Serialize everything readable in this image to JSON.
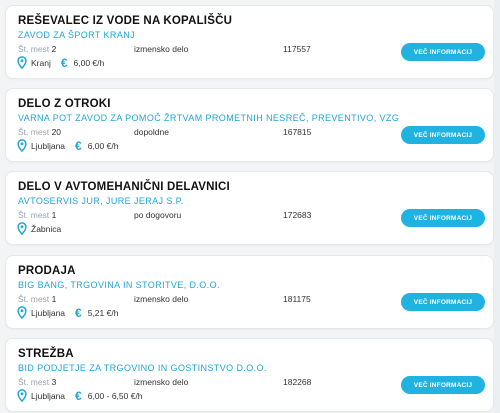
{
  "accent_color": "#20b3e2",
  "labels": {
    "seats": "Št. mest",
    "more_button": "VEČ INFORMACIJ"
  },
  "jobs": [
    {
      "title": "REŠEVALEC IZ VODE NA KOPALIŠČU",
      "company": "ZAVOD ZA ŠPORT KRANJ",
      "seats": "2",
      "type": "izmensko delo",
      "code": "117557",
      "location": "Kranj",
      "pay": "6,00 €/h"
    },
    {
      "title": "DELO Z OTROKI",
      "company": "VARNA POT ZAVOD ZA POMOČ ŽRTVAM PROMETNIH NESREČ, PREVENTIVO, VZG",
      "seats": "20",
      "type": "dopoldne",
      "code": "167815",
      "location": "Ljubljana",
      "pay": "6,00 €/h"
    },
    {
      "title": "DELO V AVTOMEHANIČNI DELAVNICI",
      "company": "AVTOSERVIS JUR, JURE JERAJ S.P.",
      "seats": "1",
      "type": "po dogovoru",
      "code": "172683",
      "location": "Žabnica",
      "pay": ""
    },
    {
      "title": "PRODAJA",
      "company": "BIG BANG, TRGOVINA IN STORITVE, D.O.O.",
      "seats": "1",
      "type": "izmensko delo",
      "code": "181175",
      "location": "Ljubljana",
      "pay": "5,21 €/h"
    },
    {
      "title": "STREŽBA",
      "company": "BID PODJETJE ZA TRGOVINO IN GOSTINSTVO D.O.O.",
      "seats": "3",
      "type": "izmensko delo",
      "code": "182268",
      "location": "Ljubljana",
      "pay": "6,00 - 6,50 €/h"
    }
  ]
}
